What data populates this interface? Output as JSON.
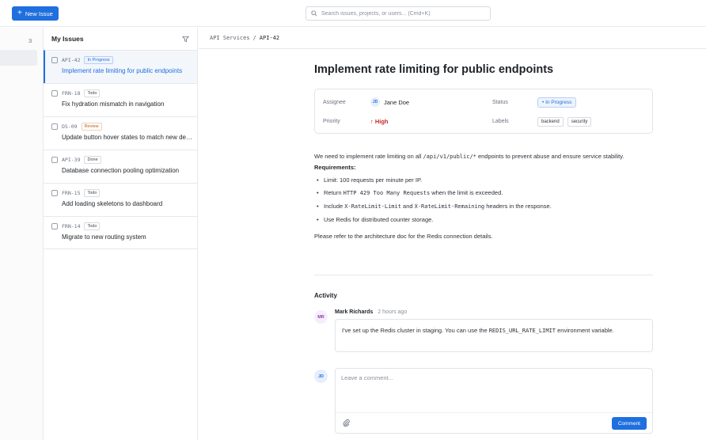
{
  "toolbar": {
    "new_issue_label": "New Issue",
    "search_placeholder": "Search issues, projects, or users... (Cmd+K)"
  },
  "sidebar": {
    "count": "3"
  },
  "issues_panel": {
    "title": "My Issues",
    "items": [
      {
        "key": "API-42",
        "status": "In Progress",
        "title": "Implement rate limiting for public endpoints"
      },
      {
        "key": "FRN-18",
        "status": "Todo",
        "title": "Fix hydration mismatch in navigation"
      },
      {
        "key": "DS-09",
        "status": "Review",
        "title": "Update button hover states to match new design"
      },
      {
        "key": "API-39",
        "status": "Done",
        "title": "Database connection pooling optimization"
      },
      {
        "key": "FRN-15",
        "status": "Todo",
        "title": "Add loading skeletons to dashboard"
      },
      {
        "key": "FRN-14",
        "status": "Todo",
        "title": "Migrate to new routing system"
      }
    ]
  },
  "breadcrumb": {
    "project": "API Services",
    "separator": "/",
    "issue": "API-42"
  },
  "issue": {
    "title": "Implement rate limiting for public endpoints",
    "assignee_label": "Assignee",
    "assignee_initials": "JD",
    "assignee_name": "Jane Doe",
    "priority_label": "Priority",
    "priority_value": "↑ High",
    "status_label": "Status",
    "status_value": "• In Progress",
    "labels_label": "Labels",
    "labels": [
      "backend",
      "security"
    ],
    "description": {
      "intro_a": "We need to implement rate limiting on all ",
      "intro_code": "/api/v1/public/*",
      "intro_b": " endpoints to prevent abuse and ensure service stability.",
      "requirements_heading": "Requirements:",
      "req1": "Limit: 100 requests per minute per IP.",
      "req2_a": "Return ",
      "req2_code": "HTTP 429 Too Many Requests",
      "req2_b": " when the limit is exceeded.",
      "req3_a": "Include ",
      "req3_code1": "X-RateLimit-Limit",
      "req3_mid": " and ",
      "req3_code2": "X-RateLimit-Remaining",
      "req3_b": " headers in the response.",
      "req4": "Use Redis for distributed counter storage.",
      "reference": "Please refer to the architecture doc for the Redis connection details."
    }
  },
  "activity": {
    "title": "Activity",
    "comment": {
      "initials": "MR",
      "author": "Mark Richards",
      "time": "2 hours ago",
      "text_a": "I've set up the Redis cluster in staging. You can use the ",
      "text_code": "REDIS_URL_RATE_LIMIT",
      "text_b": " environment variable."
    },
    "me_initials": "JD",
    "compose_placeholder": "Leave a comment...",
    "comment_button": "Comment"
  },
  "colors": {
    "accent": "#1f6fde",
    "priority_high": "#c62828"
  }
}
